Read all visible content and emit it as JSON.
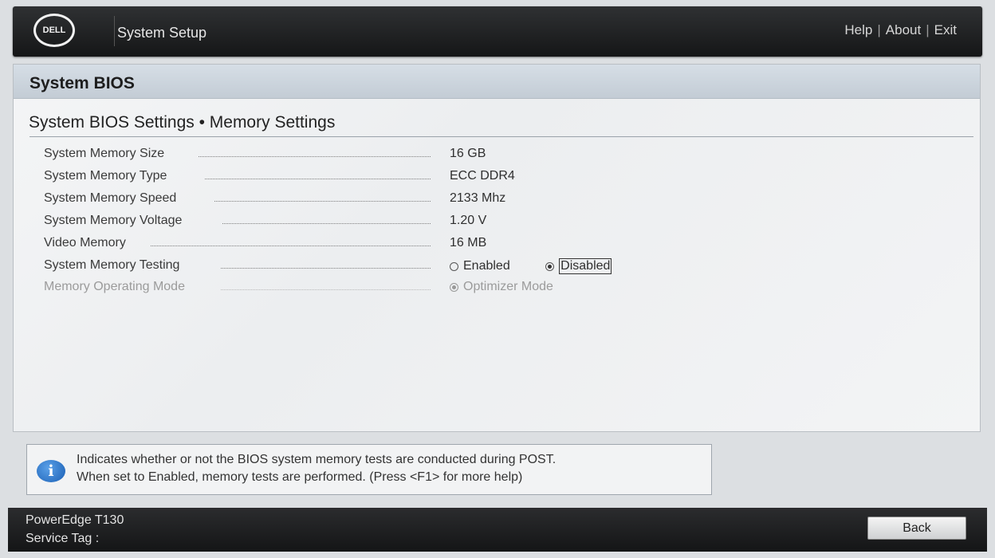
{
  "header": {
    "logo_text": "DELL",
    "app_title": "System Setup",
    "links": [
      "Help",
      "About",
      "Exit"
    ]
  },
  "panel": {
    "title": "System BIOS",
    "breadcrumb": "System BIOS Settings • Memory Settings"
  },
  "settings": [
    {
      "label": "System Memory Size",
      "value": "16 GB"
    },
    {
      "label": "System Memory Type",
      "value": "ECC DDR4"
    },
    {
      "label": "System Memory Speed",
      "value": "2133 Mhz"
    },
    {
      "label": "System Memory Voltage",
      "value": "1.20 V"
    },
    {
      "label": "Video Memory",
      "value": "16 MB"
    },
    {
      "label": "System Memory Testing",
      "options": [
        "Enabled",
        "Disabled"
      ],
      "selected": "Disabled"
    },
    {
      "label": "Memory Operating Mode",
      "options": [
        "Optimizer Mode"
      ],
      "selected": "Optimizer Mode",
      "disabled": true
    }
  ],
  "help": {
    "line1": "Indicates whether or not the BIOS system memory tests are conducted during POST.",
    "line2": "When set to Enabled, memory tests are performed. (Press <F1> for more help)"
  },
  "footer": {
    "model": "PowerEdge T130",
    "service_tag_label": "Service Tag :",
    "back_label": "Back"
  }
}
